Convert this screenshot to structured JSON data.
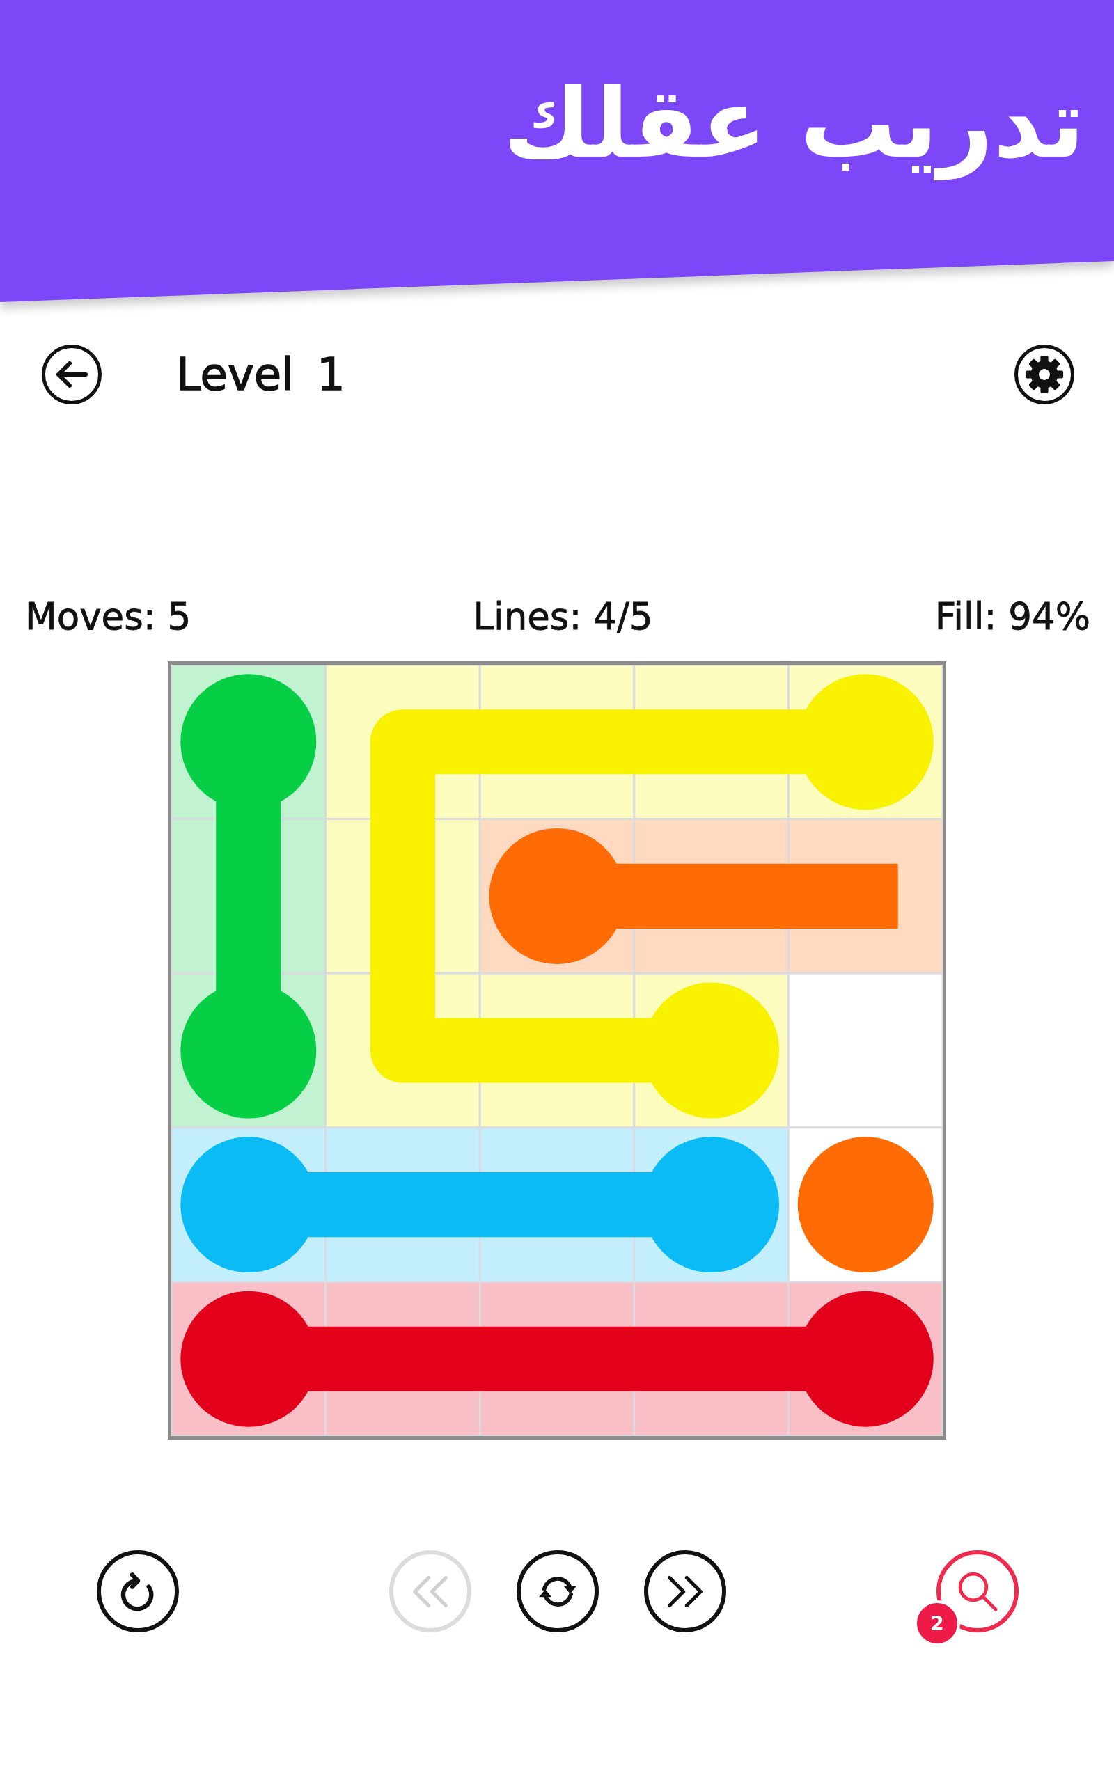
{
  "banner": {
    "title": "تدريب عقلك"
  },
  "top_bar": {
    "title": "Level 1"
  },
  "stats": {
    "moves": "Moves: 5",
    "lines": "Lines: 4/5",
    "fill": "Fill: 94%"
  },
  "board": {
    "rows": [
      {
        "cells": [
          {
            "color": "#06cf46",
            "dot": true,
            "filled": true
          },
          {
            "color": "#f8f100",
            "dot": false,
            "filled": true
          },
          {
            "color": "#f8f100",
            "dot": false,
            "filled": true
          },
          {
            "color": "#f8f100",
            "dot": false,
            "filled": true
          },
          {
            "color": "#f8f100",
            "dot": true,
            "filled": true
          }
        ]
      },
      {
        "cells": [
          {
            "color": "#06cf46",
            "dot": false,
            "filled": true
          },
          {
            "color": "#f8f100",
            "dot": false,
            "filled": true
          },
          {
            "color": "#ff6b04",
            "dot": true,
            "filled": true
          },
          {
            "color": "#ff6b04",
            "dot": false,
            "filled": true
          },
          {
            "color": "#ff6b04",
            "dot": false,
            "filled": true
          }
        ]
      },
      {
        "cells": [
          {
            "color": "#06cf46",
            "dot": true,
            "filled": true
          },
          {
            "color": "#f8f100",
            "dot": false,
            "filled": true
          },
          {
            "color": "#f8f100",
            "dot": false,
            "filled": true
          },
          {
            "color": "#f8f100",
            "dot": true,
            "filled": true
          },
          {
            "dot": false,
            "filled": false
          }
        ]
      },
      {
        "cells": [
          {
            "color": "#0bbbf5",
            "dot": true,
            "filled": true
          },
          {
            "color": "#0bbbf5",
            "dot": false,
            "filled": true
          },
          {
            "color": "#0bbbf5",
            "dot": false,
            "filled": true
          },
          {
            "color": "#0bbbf5",
            "dot": true,
            "filled": true
          },
          {
            "color": "#ff6b04",
            "dot": true,
            "filled": false
          }
        ]
      },
      {
        "cells": [
          {
            "color": "#e3001b",
            "dot": true,
            "filled": true
          },
          {
            "color": "#e3001b",
            "dot": false,
            "filled": true
          },
          {
            "color": "#e3001b",
            "dot": false,
            "filled": true
          },
          {
            "color": "#e3001b",
            "dot": false,
            "filled": true
          },
          {
            "color": "#e3001b",
            "dot": true,
            "filled": true
          }
        ]
      }
    ]
  },
  "toolbar": [
    {
      "kind": "restart",
      "disabled": false
    },
    {
      "kind": "previous",
      "disabled": true
    },
    {
      "kind": "reset",
      "disabled": false
    },
    {
      "kind": "next",
      "disabled": false
    },
    {
      "kind": "hint",
      "disabled": false,
      "badge": "2"
    }
  ]
}
